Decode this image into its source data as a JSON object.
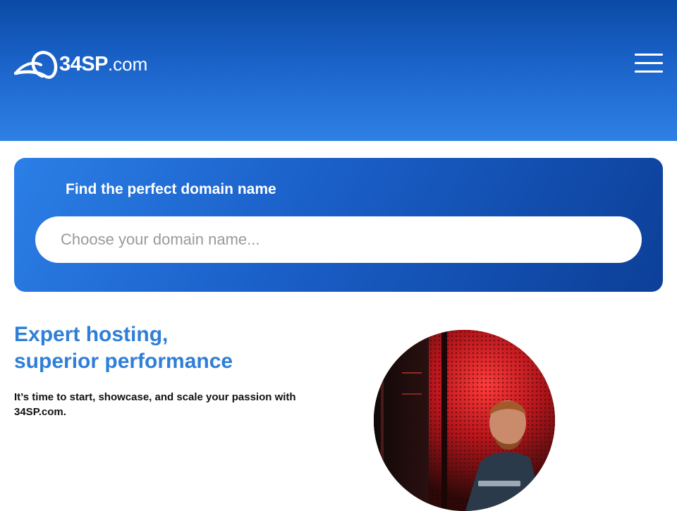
{
  "header": {
    "logo": {
      "brand_bold": "34SP",
      "brand_suffix": ".com",
      "mark_icon": "swoosh-logo-icon"
    },
    "menu_icon": "hamburger-menu-icon"
  },
  "domain_search": {
    "heading": "Find the perfect domain name",
    "placeholder": "Choose your domain name..."
  },
  "hero": {
    "title_line1": "Expert hosting,",
    "title_line2": "superior performance",
    "body": "It’s time to start, showcase, and scale your passion with 34SP.com."
  },
  "colors": {
    "header_top": "#0b4aa6",
    "header_bottom": "#2f80e6",
    "accent_blue": "#2f7ed8",
    "card_dark": "#0c3f98",
    "white": "#ffffff"
  }
}
